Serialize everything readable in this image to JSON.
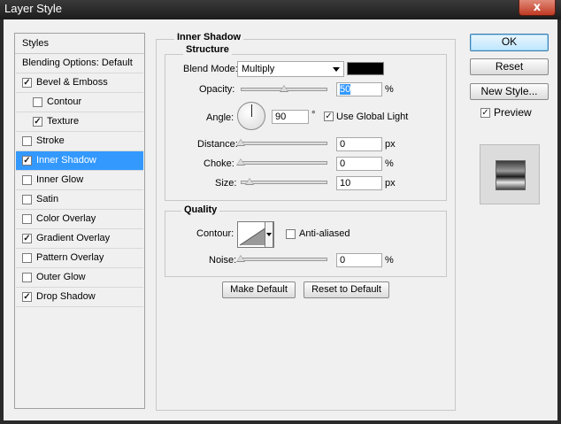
{
  "window": {
    "title": "Layer Style",
    "close_glyph": "x"
  },
  "styles_panel": {
    "header": "Styles",
    "blending": "Blending Options: Default",
    "items": [
      {
        "label": "Bevel & Emboss",
        "checked": true,
        "indent": false
      },
      {
        "label": "Contour",
        "checked": false,
        "indent": true
      },
      {
        "label": "Texture",
        "checked": true,
        "indent": true
      },
      {
        "label": "Stroke",
        "checked": false,
        "indent": false
      },
      {
        "label": "Inner Shadow",
        "checked": true,
        "indent": false,
        "selected": true
      },
      {
        "label": "Inner Glow",
        "checked": false,
        "indent": false
      },
      {
        "label": "Satin",
        "checked": false,
        "indent": false
      },
      {
        "label": "Color Overlay",
        "checked": false,
        "indent": false
      },
      {
        "label": "Gradient Overlay",
        "checked": true,
        "indent": false
      },
      {
        "label": "Pattern Overlay",
        "checked": false,
        "indent": false
      },
      {
        "label": "Outer Glow",
        "checked": false,
        "indent": false
      },
      {
        "label": "Drop Shadow",
        "checked": true,
        "indent": false
      }
    ]
  },
  "inner_shadow": {
    "title": "Inner Shadow",
    "structure": {
      "title": "Structure",
      "blend_mode_label": "Blend Mode:",
      "blend_mode_value": "Multiply",
      "shadow_color": "#000000",
      "opacity_label": "Opacity:",
      "opacity_value": "50",
      "opacity_unit": "%",
      "angle_label": "Angle:",
      "angle_value": "90",
      "angle_unit": "°",
      "use_global_light_label": "Use Global Light",
      "use_global_light_checked": true,
      "distance_label": "Distance:",
      "distance_value": "0",
      "distance_unit": "px",
      "choke_label": "Choke:",
      "choke_value": "0",
      "choke_unit": "%",
      "size_label": "Size:",
      "size_value": "10",
      "size_unit": "px"
    },
    "quality": {
      "title": "Quality",
      "contour_label": "Contour:",
      "anti_aliased_label": "Anti-aliased",
      "anti_aliased_checked": false,
      "noise_label": "Noise:",
      "noise_value": "0",
      "noise_unit": "%"
    },
    "make_default_label": "Make Default",
    "reset_default_label": "Reset to Default"
  },
  "buttons": {
    "ok": "OK",
    "reset": "Reset",
    "new_style": "New Style...",
    "preview_label": "Preview",
    "preview_checked": true
  },
  "check_glyph": "✓"
}
